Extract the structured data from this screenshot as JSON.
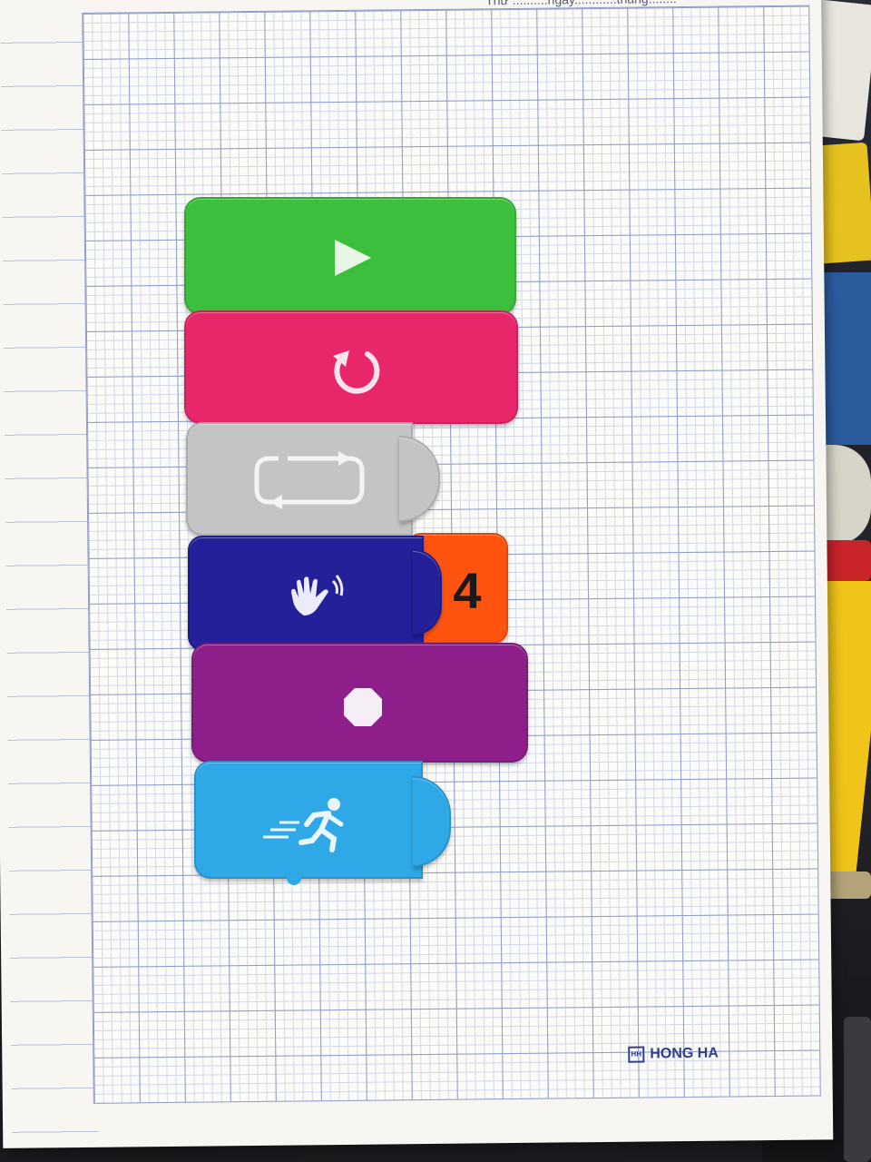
{
  "notebook": {
    "date_line": "Thứ ..........ngày............tháng........",
    "brand_logo": "HH",
    "brand_name": "HONG HA"
  },
  "blocks": [
    {
      "name": "start-block",
      "color": "#3cbf3c",
      "icon": "play-icon"
    },
    {
      "name": "repeat-once-block",
      "color": "#e8266a",
      "icon": "rotate-icon"
    },
    {
      "name": "loop-block",
      "color": "#c4c4c4",
      "icon": "loop-icon"
    },
    {
      "name": "wave-block",
      "color": "#23209a",
      "icon": "hand-wave-icon"
    },
    {
      "name": "number-block",
      "color": "#ff5410",
      "value": "4"
    },
    {
      "name": "stop-block",
      "color": "#8e1e8a",
      "icon": "stop-octagon-icon"
    },
    {
      "name": "run-block",
      "color": "#2ea8e6",
      "icon": "running-person-icon"
    }
  ]
}
